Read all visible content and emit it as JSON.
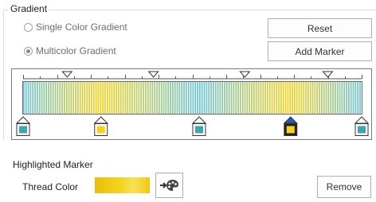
{
  "gradient": {
    "title": "Gradient",
    "single_option": "Single Color Gradient",
    "multi_option": "Multicolor Gradient",
    "selected_option": "multi",
    "reset_label": "Reset",
    "add_marker_label": "Add Marker",
    "base_color": "#6cc5d6",
    "accent_color": "#f5d21c",
    "markers": [
      {
        "position": 0.0,
        "color": "#3ea7ad",
        "selected": false
      },
      {
        "position": 0.23,
        "color": "#f5d21c",
        "selected": false
      },
      {
        "position": 0.52,
        "color": "#3ea7ad",
        "selected": false
      },
      {
        "position": 0.79,
        "color": "#f5d21c",
        "selected": true
      },
      {
        "position": 1.0,
        "color": "#3ea7ad",
        "selected": false
      }
    ],
    "midpoints": [
      0.13,
      0.385,
      0.655,
      0.9
    ]
  },
  "highlighted": {
    "title": "Highlighted Marker",
    "thread_color_label": "Thread Color",
    "thread_color": "#f5d21c",
    "picker_icon": "arrow-palette-icon",
    "remove_label": "Remove"
  }
}
